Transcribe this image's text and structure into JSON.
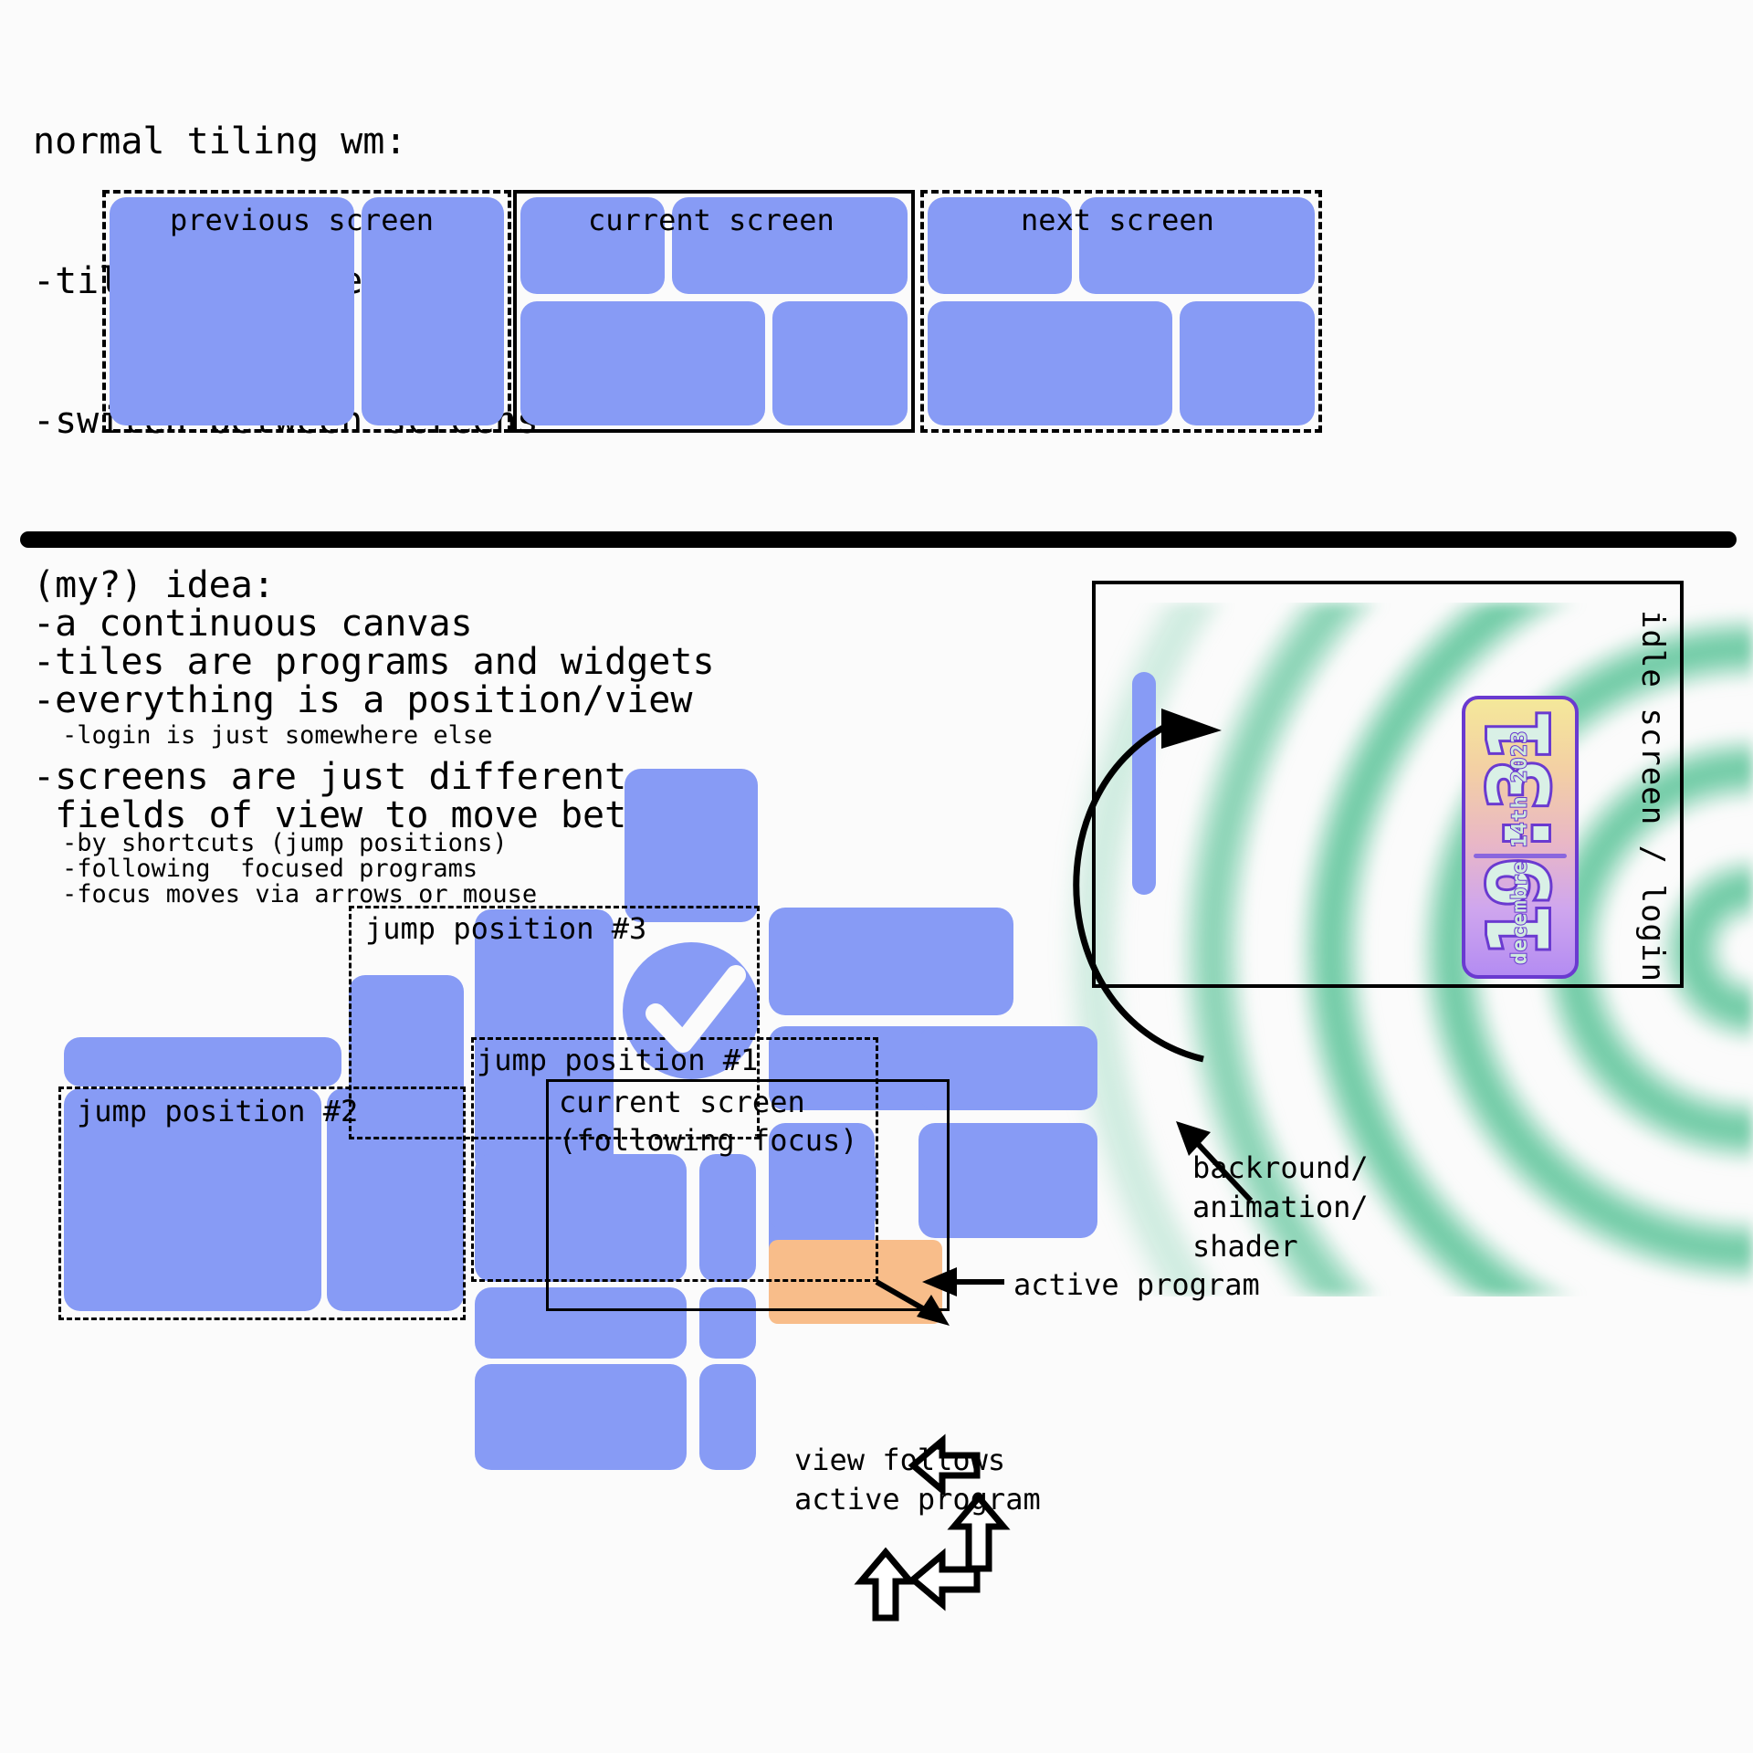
{
  "top_section": {
    "heading_lines": [
      "normal tiling wm:",
      "-tiles on screens",
      "-switch between screens"
    ],
    "screens": [
      {
        "label": "previous screen",
        "border": "dashed"
      },
      {
        "label": "current screen",
        "border": "solid"
      },
      {
        "label": "next screen",
        "border": "dashed"
      }
    ]
  },
  "divider": {
    "color": "#000000"
  },
  "bottom_section": {
    "heading": "(my?) idea:",
    "bullets": [
      "-a continuous canvas",
      "-tiles are programs and widgets",
      "-everything is a position/view"
    ],
    "sub_bullet_login": "-login is just somewhere else",
    "bullet_screens_line1": "-screens are just different",
    "bullet_screens_line2": " fields of view to move between",
    "sub_bullets": [
      "-by shortcuts (jump positions)",
      "-following  focused programs",
      "-focus moves via arrows or mouse"
    ],
    "jump_positions": [
      {
        "label": "jump position #3"
      },
      {
        "label": "jump position #1"
      },
      {
        "label": "jump position #2"
      }
    ],
    "current_screen_line1": "current screen",
    "current_screen_line2": "(following focus)",
    "annotations": {
      "active_program": "active program",
      "view_follows_line1": "view follows",
      "view_follows_line2": "active program",
      "background_line1": "backround/",
      "background_line2": "animation/",
      "background_line3": "shader"
    }
  },
  "idle_screen": {
    "label": "idle screen / login",
    "clock": {
      "time": "19:31",
      "date": "decembre 14th 2023"
    }
  },
  "colors": {
    "tile": "#879bf5",
    "active_tile": "#f8bd8a",
    "ring": "#4abe8e",
    "clock_border": "#6a3ad0",
    "page_bg": "#fbfbfb"
  }
}
